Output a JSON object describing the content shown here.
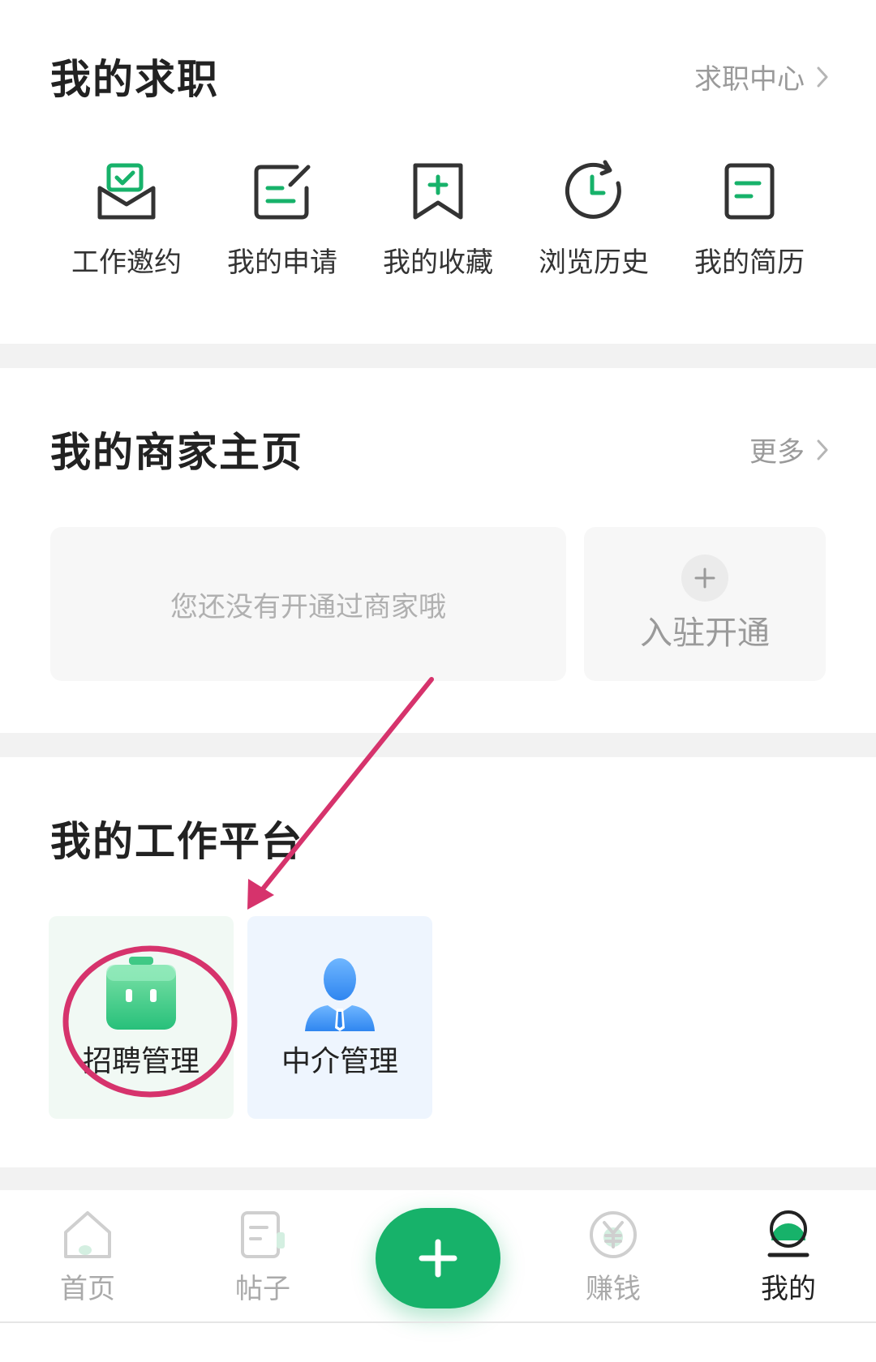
{
  "colors": {
    "brand_green": "#17b26a",
    "annotation_magenta": "#d6336c",
    "muted_text": "#9a9a9a",
    "card_recruit_bg": "#f1f9f4",
    "card_agent_bg": "#eef5fe"
  },
  "job_section": {
    "title": "我的求职",
    "link": "求职中心",
    "items": [
      {
        "label": "工作邀约",
        "icon": "invitation-envelope-icon"
      },
      {
        "label": "我的申请",
        "icon": "application-edit-icon"
      },
      {
        "label": "我的收藏",
        "icon": "bookmark-add-icon"
      },
      {
        "label": "浏览历史",
        "icon": "history-clock-icon"
      },
      {
        "label": "我的简历",
        "icon": "resume-document-icon"
      }
    ]
  },
  "merchant_section": {
    "title": "我的商家主页",
    "link": "更多",
    "empty_text": "您还没有开通过商家哦",
    "join_label": "入驻开通"
  },
  "work_section": {
    "title": "我的工作平台",
    "cards": [
      {
        "label": "招聘管理",
        "icon": "briefcase-icon"
      },
      {
        "label": "中介管理",
        "icon": "agent-person-icon"
      }
    ]
  },
  "tabbar": {
    "items": [
      {
        "label": "首页",
        "icon": "home-icon",
        "active": false
      },
      {
        "label": "帖子",
        "icon": "post-icon",
        "active": false
      },
      {
        "label": "赚钱",
        "icon": "yen-coin-icon",
        "active": false
      },
      {
        "label": "我的",
        "icon": "profile-icon",
        "active": true
      }
    ],
    "fab_icon": "plus-icon"
  }
}
